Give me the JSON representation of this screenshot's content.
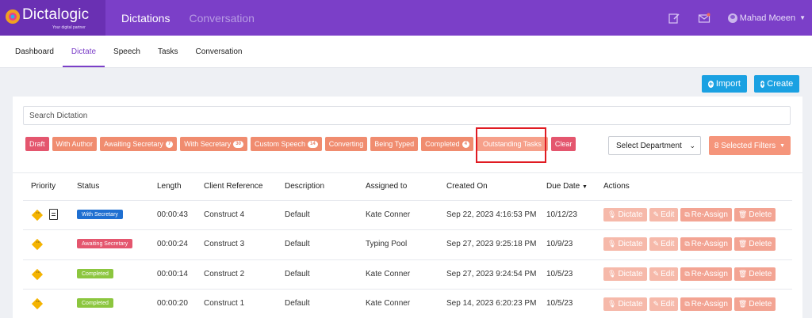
{
  "brand": {
    "name": "Dictalogic",
    "tagline": "Your digital partner"
  },
  "topnav": [
    {
      "label": "Dictations"
    },
    {
      "label": "Conversation"
    }
  ],
  "user": {
    "name": "Mahad Moeen"
  },
  "subnav": [
    {
      "label": "Dashboard"
    },
    {
      "label": "Dictate"
    },
    {
      "label": "Speech"
    },
    {
      "label": "Tasks"
    },
    {
      "label": "Conversation"
    }
  ],
  "buttons": {
    "import": "Import",
    "create": "Create"
  },
  "search": {
    "placeholder": "Search Dictation"
  },
  "chips": [
    {
      "label": "Draft",
      "count": ""
    },
    {
      "label": "With Author",
      "count": ""
    },
    {
      "label": "Awaiting Secretary",
      "count": "7"
    },
    {
      "label": "With Secretary",
      "count": "30"
    },
    {
      "label": "Custom Speech",
      "count": "14"
    },
    {
      "label": "Converting",
      "count": ""
    },
    {
      "label": "Being Typed",
      "count": ""
    },
    {
      "label": "Completed",
      "count": "4"
    },
    {
      "label": "Outstanding Tasks",
      "count": ""
    },
    {
      "label": "Clear",
      "count": ""
    }
  ],
  "department": {
    "label": "Select Department"
  },
  "filters": {
    "label": "8 Selected Filters"
  },
  "table": {
    "headers": [
      "Priority",
      "Status",
      "Length",
      "Client Reference",
      "Description",
      "Assigned to",
      "Created On",
      "Due Date",
      "Actions"
    ],
    "rows": [
      {
        "status": "With Secretary",
        "length": "00:00:43",
        "client": "Construct 4",
        "desc": "Default",
        "assigned": "Kate Conner",
        "created": "Sep 22, 2023 4:16:53 PM",
        "due": "10/12/23"
      },
      {
        "status": "Awaiting Secretary",
        "length": "00:00:24",
        "client": "Construct 3",
        "desc": "Default",
        "assigned": "Typing Pool",
        "created": "Sep 27, 2023 9:25:18 PM",
        "due": "10/9/23"
      },
      {
        "status": "Completed",
        "length": "00:00:14",
        "client": "Construct 2",
        "desc": "Default",
        "assigned": "Kate Conner",
        "created": "Sep 27, 2023 9:24:54 PM",
        "due": "10/5/23"
      },
      {
        "status": "Completed",
        "length": "00:00:20",
        "client": "Construct 1",
        "desc": "Default",
        "assigned": "Kate Conner",
        "created": "Sep 14, 2023 6:20:23 PM",
        "due": "10/5/23"
      }
    ],
    "actions": {
      "dictate": "Dictate",
      "edit": "Edit",
      "reassign": "Re-Assign",
      "delete": "Delete"
    }
  },
  "colors": {
    "brand": "#7b3fc8",
    "primary": "#1aa1e2",
    "danger": "#e4566e",
    "salmon": "#f08c6f",
    "blue_badge": "#1f6fd1",
    "green_badge": "#8cc63f"
  }
}
